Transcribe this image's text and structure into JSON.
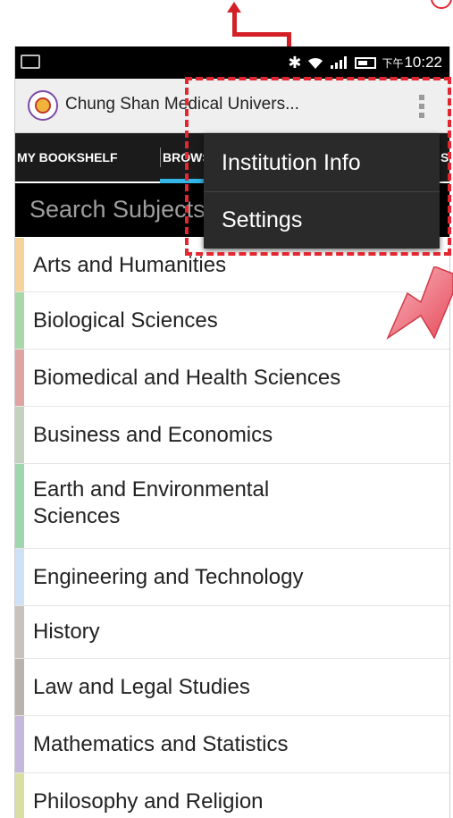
{
  "status_bar": {
    "time_prefix": "下午",
    "time": "10:22",
    "icons": [
      "keyboard-icon",
      "bluetooth-icon",
      "wifi-icon",
      "signal-icon",
      "battery-icon"
    ]
  },
  "action_bar": {
    "title": "Chung Shan Medical Univers...",
    "overflow_icon": "overflow-menu-icon"
  },
  "tabs": [
    {
      "label": "MY BOOKSHELF"
    },
    {
      "label": "BROWSE"
    },
    {
      "label": "S"
    }
  ],
  "search": {
    "placeholder": "Search Subjects"
  },
  "menu": {
    "items": [
      {
        "label": "Institution Info"
      },
      {
        "label": "Settings"
      }
    ]
  },
  "subjects": [
    {
      "label": "Arts and Humanities",
      "color": "#f5d39b"
    },
    {
      "label": "Biological Sciences",
      "color": "#a8d8a8"
    },
    {
      "label": "Biomedical and Health Sciences",
      "color": "#e0a3a3"
    },
    {
      "label": "Business and Economics",
      "color": "#c3d2bf"
    },
    {
      "label": "Earth and Environmental Sciences",
      "color": "#9fd6b0"
    },
    {
      "label": "Engineering and Technology",
      "color": "#cfe2f5"
    },
    {
      "label": "History",
      "color": "#c8c2bd"
    },
    {
      "label": "Law and Legal Studies",
      "color": "#bab2ac"
    },
    {
      "label": "Mathematics and Statistics",
      "color": "#c4b8db"
    },
    {
      "label": "Philosophy and Religion",
      "color": "#d9dfa1"
    }
  ],
  "colors": {
    "annotation_red": "#e3262f",
    "tab_indicator": "#33b5e5"
  }
}
